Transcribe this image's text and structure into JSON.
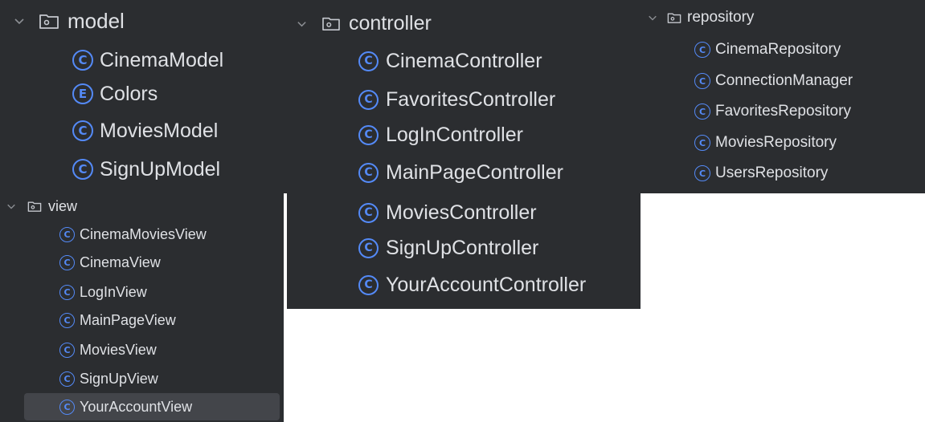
{
  "model": {
    "folder": "model",
    "items": [
      {
        "badge": "C",
        "label": "CinemaModel"
      },
      {
        "badge": "E",
        "label": "Colors"
      },
      {
        "badge": "C",
        "label": "MoviesModel"
      },
      {
        "badge": "C",
        "label": "SignUpModel"
      }
    ]
  },
  "controller": {
    "folder": "controller",
    "items": [
      {
        "badge": "C",
        "label": "CinemaController"
      },
      {
        "badge": "C",
        "label": "FavoritesController"
      },
      {
        "badge": "C",
        "label": "LogInController"
      },
      {
        "badge": "C",
        "label": "MainPageController"
      },
      {
        "badge": "C",
        "label": "MoviesController"
      },
      {
        "badge": "C",
        "label": "SignUpController"
      },
      {
        "badge": "C",
        "label": "YourAccountController"
      }
    ]
  },
  "repository": {
    "folder": "repository",
    "items": [
      {
        "badge": "C",
        "label": "CinemaRepository"
      },
      {
        "badge": "C",
        "label": "ConnectionManager"
      },
      {
        "badge": "C",
        "label": "FavoritesRepository"
      },
      {
        "badge": "C",
        "label": "MoviesRepository"
      },
      {
        "badge": "C",
        "label": "UsersRepository"
      }
    ]
  },
  "view": {
    "folder": "view",
    "selected_item": "YourAccountView",
    "items": [
      {
        "badge": "C",
        "label": "CinemaMoviesView"
      },
      {
        "badge": "C",
        "label": "CinemaView"
      },
      {
        "badge": "C",
        "label": "LogInView"
      },
      {
        "badge": "C",
        "label": "MainPageView"
      },
      {
        "badge": "C",
        "label": "MoviesView"
      },
      {
        "badge": "C",
        "label": "SignUpView"
      },
      {
        "badge": "C",
        "label": "YourAccountView"
      }
    ]
  },
  "icons": {
    "expand": "chevron-down-icon",
    "folder": "package-folder-icon",
    "class": "class-icon",
    "enum": "enum-icon"
  },
  "colors": {
    "background": "#2b2d30",
    "text": "#dfe1e5",
    "badge": "#548af7",
    "selection": "#43454a"
  }
}
